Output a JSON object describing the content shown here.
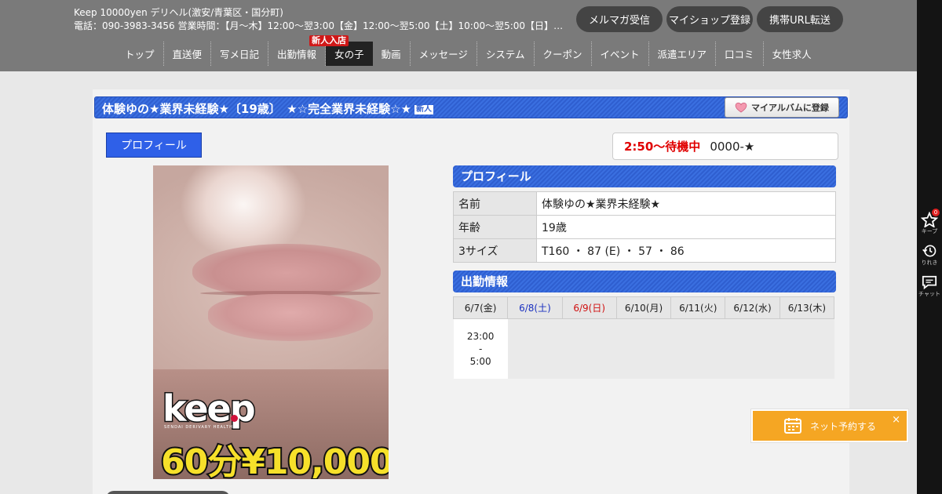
{
  "header": {
    "shop_name": "Keep 10000yen デリヘル(激安/青葉区・国分町)",
    "shop_info": "電話：090-3983-3456 営業時間：【月～木】12:00～翌3:00【金】12:00～翌5:00【土】10:00～翌5:00【日】10:00…",
    "buttons": [
      {
        "label": "メルマガ受信"
      },
      {
        "label": "マイショップ登録"
      },
      {
        "label": "携帯URL転送"
      }
    ]
  },
  "nav": {
    "items": [
      {
        "label": "トップ"
      },
      {
        "label": "直送便"
      },
      {
        "label": "写メ日記"
      },
      {
        "label": "出勤情報"
      },
      {
        "label": "女の子"
      },
      {
        "label": "動画"
      },
      {
        "label": "メッセージ"
      },
      {
        "label": "システム"
      },
      {
        "label": "クーポン"
      },
      {
        "label": "イベント"
      },
      {
        "label": "派遣エリア"
      },
      {
        "label": "口コミ"
      },
      {
        "label": "女性求人"
      }
    ],
    "active_index": 4,
    "new_badge": "新人入店"
  },
  "sidebar": {
    "keep_label": "キープ",
    "keep_count": "0",
    "history_label": "りれき",
    "chat_label": "チャット"
  },
  "profile_page": {
    "title": "体験ゆの★業界未経験★〔19歳〕　★☆完全業界未経験☆★",
    "title_new": "新人",
    "album_button": "マイアルバムに登録",
    "tab_label": "プロフィール",
    "status_time": "2:50～待機中",
    "status_extra": "0000-★"
  },
  "photo": {
    "logo_text": "keep",
    "logo_sub": "SENDAI DERIVARY HEALTH",
    "price_text": "60分¥10,000"
  },
  "profile": {
    "heading": "プロフィール",
    "rows": [
      {
        "key": "名前",
        "value": "体験ゆの★業界未経験★"
      },
      {
        "key": "年齢",
        "value": "19歳"
      },
      {
        "key": "3サイズ",
        "value": "T160 ・ 87 (E) ・ 57 ・ 86"
      }
    ]
  },
  "schedule": {
    "heading": "出勤情報",
    "days": [
      {
        "label": "6/7(金)",
        "type": "weekday",
        "time": [
          "23:00",
          "-",
          "5:00"
        ]
      },
      {
        "label": "6/8(土)",
        "type": "sat",
        "time": []
      },
      {
        "label": "6/9(日)",
        "type": "sun",
        "time": []
      },
      {
        "label": "6/10(月)",
        "type": "weekday",
        "time": []
      },
      {
        "label": "6/11(火)",
        "type": "weekday",
        "time": []
      },
      {
        "label": "6/12(水)",
        "type": "weekday",
        "time": []
      },
      {
        "label": "6/13(木)",
        "type": "weekday",
        "time": []
      }
    ]
  },
  "reserve": {
    "label": "ネット予約する",
    "close": "×"
  }
}
